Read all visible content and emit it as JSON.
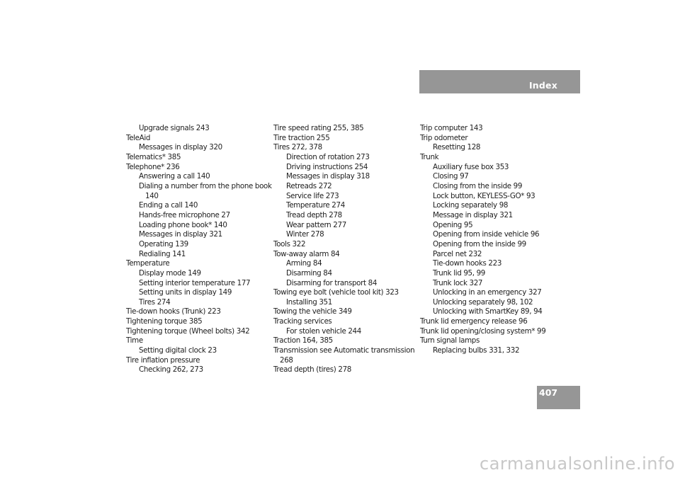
{
  "header": {
    "title": "Index"
  },
  "page_number": "407",
  "columns": [
    [
      {
        "text": "Upgrade signals 243",
        "level": 2
      },
      {
        "text": "TeleAid",
        "level": 1
      },
      {
        "text": "Messages in display 320",
        "level": 2
      },
      {
        "text": "Telematics* 385",
        "level": 1
      },
      {
        "text": "Telephone* 236",
        "level": 1
      },
      {
        "text": "Answering a call 140",
        "level": 2
      },
      {
        "text": "Dialing a number from the phone book",
        "level": 2
      },
      {
        "text": "140",
        "level": "cont2"
      },
      {
        "text": "Ending a call 140",
        "level": 2
      },
      {
        "text": "Hands-free microphone 27",
        "level": 2
      },
      {
        "text": "Loading phone book* 140",
        "level": 2
      },
      {
        "text": "Messages in display 321",
        "level": 2
      },
      {
        "text": "Operating 139",
        "level": 2
      },
      {
        "text": "Redialing 141",
        "level": 2
      },
      {
        "text": "Temperature",
        "level": 1
      },
      {
        "text": "Display mode 149",
        "level": 2
      },
      {
        "text": "Setting interior temperature 177",
        "level": 2
      },
      {
        "text": "Setting units in display 149",
        "level": 2
      },
      {
        "text": "Tires 274",
        "level": 2
      },
      {
        "text": "Tie-down hooks (Trunk) 223",
        "level": 1
      },
      {
        "text": "Tightening torque 385",
        "level": 1
      },
      {
        "text": "Tightening torque (Wheel bolts) 342",
        "level": 1
      },
      {
        "text": "Time",
        "level": 1
      },
      {
        "text": "Setting digital clock 23",
        "level": 2
      },
      {
        "text": "Tire inflation pressure",
        "level": 1
      },
      {
        "text": "Checking 262, 273",
        "level": 2
      }
    ],
    [
      {
        "text": "Tire speed rating 255, 385",
        "level": 1
      },
      {
        "text": "Tire traction 255",
        "level": 1
      },
      {
        "text": "Tires 272, 378",
        "level": 1
      },
      {
        "text": "Direction of rotation 273",
        "level": 2
      },
      {
        "text": "Driving instructions 254",
        "level": 2
      },
      {
        "text": "Messages in display 318",
        "level": 2
      },
      {
        "text": "Retreads 272",
        "level": 2
      },
      {
        "text": "Service life 273",
        "level": 2
      },
      {
        "text": "Temperature 274",
        "level": 2
      },
      {
        "text": "Tread depth 278",
        "level": 2
      },
      {
        "text": "Wear pattern 277",
        "level": 2
      },
      {
        "text": "Winter 278",
        "level": 2
      },
      {
        "text": "Tools 322",
        "level": 1
      },
      {
        "text": "Tow-away alarm 84",
        "level": 1
      },
      {
        "text": "Arming 84",
        "level": 2
      },
      {
        "text": "Disarming 84",
        "level": 2
      },
      {
        "text": "Disarming for transport 84",
        "level": 2
      },
      {
        "text": "Towing eye bolt (vehicle tool kit) 323",
        "level": 1
      },
      {
        "text": "Installing 351",
        "level": 2
      },
      {
        "text": "Towing the vehicle 349",
        "level": 1
      },
      {
        "text": "Tracking services",
        "level": 1
      },
      {
        "text": "For stolen vehicle 244",
        "level": 2
      },
      {
        "text": "Traction 164, 385",
        "level": 1
      },
      {
        "text": "Transmission see Automatic transmission",
        "level": 1
      },
      {
        "text": "268",
        "level": "cont1"
      },
      {
        "text": "Tread depth (tires) 278",
        "level": 1
      }
    ],
    [
      {
        "text": "Trip computer 143",
        "level": 1
      },
      {
        "text": "Trip odometer",
        "level": 1
      },
      {
        "text": "Resetting 128",
        "level": 2
      },
      {
        "text": "Trunk",
        "level": 1
      },
      {
        "text": "Auxiliary fuse box 353",
        "level": 2
      },
      {
        "text": "Closing 97",
        "level": 2
      },
      {
        "text": "Closing from the inside 99",
        "level": 2
      },
      {
        "text": "Lock button, KEYLESS-GO* 93",
        "level": 2
      },
      {
        "text": "Locking separately 98",
        "level": 2
      },
      {
        "text": "Message in display 321",
        "level": 2
      },
      {
        "text": "Opening 95",
        "level": 2
      },
      {
        "text": "Opening from inside vehicle 96",
        "level": 2
      },
      {
        "text": "Opening from the inside 99",
        "level": 2
      },
      {
        "text": "Parcel net 232",
        "level": 2
      },
      {
        "text": "Tie-down hooks 223",
        "level": 2
      },
      {
        "text": "Trunk lid 95, 99",
        "level": 2
      },
      {
        "text": "Trunk lock 327",
        "level": 2
      },
      {
        "text": "Unlocking in an emergency 327",
        "level": 2
      },
      {
        "text": "Unlocking separately 98, 102",
        "level": 2
      },
      {
        "text": "Unlocking with SmartKey 89, 94",
        "level": 2
      },
      {
        "text": "Trunk lid emergency release 96",
        "level": 1
      },
      {
        "text": "Trunk lid opening/closing system* 99",
        "level": 1
      },
      {
        "text": "Turn signal lamps",
        "level": 1
      },
      {
        "text": "Replacing bulbs 331, 332",
        "level": 2
      }
    ]
  ],
  "watermark": "carmanualsonline.info",
  "colors": {
    "header_bar": "#969696",
    "header_text": "#ffffff",
    "body_text": "#1e1e1e"
  }
}
